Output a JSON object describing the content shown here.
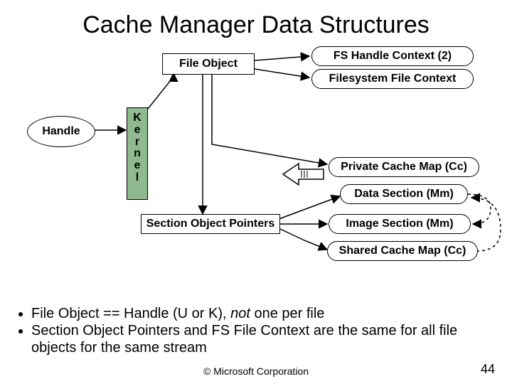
{
  "title": "Cache Manager Data Structures",
  "nodes": {
    "handle": "Handle",
    "kernel": "K\ne\nr\nn\ne\nl",
    "file_object": "File Object",
    "fs_handle_context": "FS Handle Context (2)",
    "filesystem_file_context": "Filesystem File Context",
    "private_cache_map": "Private Cache Map (Cc)",
    "data_section": "Data Section (Mm)",
    "section_object_pointers": "Section Object Pointers",
    "image_section": "Image Section (Mm)",
    "shared_cache_map": "Shared Cache Map (Cc)"
  },
  "bullets": [
    "File Object == Handle (U or K), not one per file",
    "Section Object Pointers and FS File Context are the same for all file objects for the same stream"
  ],
  "bullets_html": [
    "File Object == Handle (U or K), <span class='italic'>not</span> one per file",
    "Section Object Pointers and FS File Context are the same for all file objects for the same stream"
  ],
  "footer": "© Microsoft Corporation",
  "page_number": "44"
}
